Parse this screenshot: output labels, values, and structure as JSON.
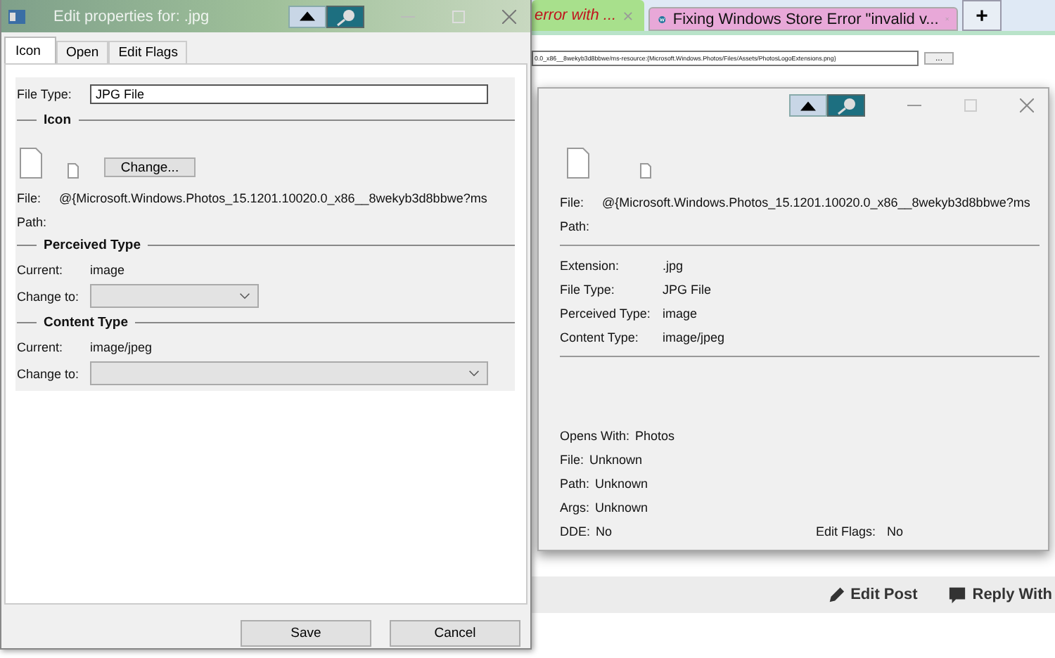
{
  "browser": {
    "tabs": [
      {
        "title": "error with ...",
        "color": "#a8e08c",
        "selected": false
      },
      {
        "title": "Fixing Windows Store Error \"invalid v...",
        "color": "#e8a8d8",
        "selected": true
      }
    ],
    "new_tab": "+",
    "path_field": "0.0_x86__8wekyb3d8bbwe/ms-resource:{Microsoft.Windows.Photos/Files/Assets/PhotosLogoExtensions.png}",
    "browse_button": "...",
    "actions": [
      "Edit Post",
      "Reply With"
    ]
  },
  "details_window": {
    "file_label": "File:",
    "file_value": "@{Microsoft.Windows.Photos_15.1201.10020.0_x86__8wekyb3d8bbwe?ms",
    "path_label": "Path:",
    "info": [
      {
        "label": "Extension:",
        "value": ".jpg"
      },
      {
        "label": "File Type:",
        "value": "JPG File"
      },
      {
        "label": "Perceived Type:",
        "value": "image"
      },
      {
        "label": "Content Type:",
        "value": "image/jpeg"
      }
    ],
    "opens_with": [
      {
        "label": "Opens With:",
        "value": "Photos"
      },
      {
        "label": "File:",
        "value": "Unknown"
      },
      {
        "label": "Path:",
        "value": "Unknown"
      },
      {
        "label": "Args:",
        "value": "Unknown"
      }
    ],
    "dde": {
      "label": "DDE:",
      "value": "No"
    },
    "edit_flags": {
      "label": "Edit Flags:",
      "value": "No"
    }
  },
  "dialog": {
    "title": "Edit properties for: .jpg",
    "tabs": [
      {
        "label": "Icon",
        "selected": true
      },
      {
        "label": "Open",
        "selected": false
      },
      {
        "label": "Edit Flags",
        "selected": false
      }
    ],
    "file_type_label": "File Type:",
    "file_type_value": "JPG File",
    "icon_section": "Icon",
    "change_button": "Change...",
    "file_label": "File:",
    "file_value": "@{Microsoft.Windows.Photos_15.1201.10020.0_x86__8wekyb3d8bbwe?ms",
    "path_label": "Path:",
    "perceived_section": "Perceived Type",
    "perceived_current_label": "Current:",
    "perceived_current": "image",
    "perceived_change_label": "Change to:",
    "content_section": "Content Type",
    "content_current_label": "Current:",
    "content_current": "image/jpeg",
    "content_change_label": "Change to:",
    "buttons": [
      "Save",
      "Cancel"
    ]
  }
}
